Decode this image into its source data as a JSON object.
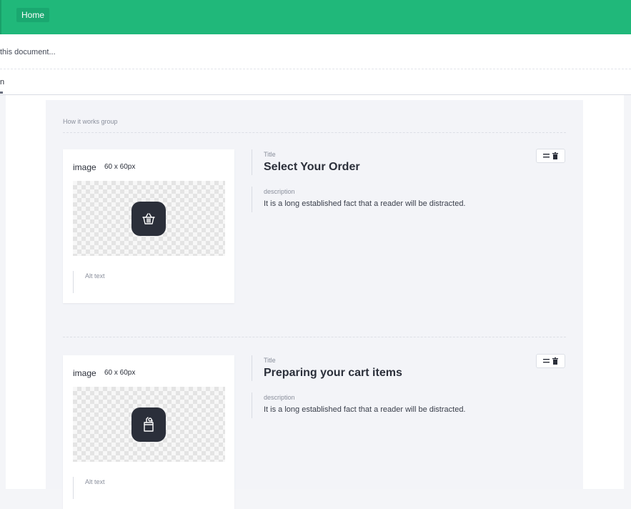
{
  "topbar": {
    "home_label": "Home"
  },
  "search": {
    "text": "this document..."
  },
  "tab": {
    "label_fragment": "n"
  },
  "group": {
    "label": "How it works group",
    "items": [
      {
        "image_label": "image",
        "image_size": "60 x 60px",
        "icon": "basket-icon",
        "alt_label": "Alt text",
        "title_label": "Title",
        "title": "Select Your Order",
        "description_label": "description",
        "description": "It is a long established fact that a reader will be distracted."
      },
      {
        "image_label": "image",
        "image_size": "60 x 60px",
        "icon": "grocery-bag-icon",
        "alt_label": "Alt text",
        "title_label": "Title",
        "title": "Preparing your cart items",
        "description_label": "description",
        "description": "It is a long established fact that a reader will be distracted."
      }
    ]
  },
  "colors": {
    "topbar": "#20b87a",
    "icon_tile": "#2b2f3a",
    "group_background": "#f3f4f8"
  }
}
